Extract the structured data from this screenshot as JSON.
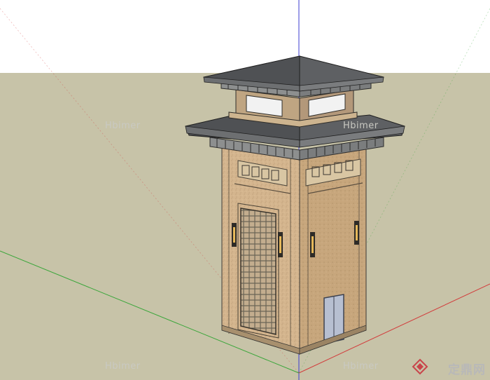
{
  "watermarks": [
    "Hbimer",
    "Hbimer",
    "Hbimer",
    "Hbimer"
  ],
  "brand": {
    "text": "定鼎网",
    "icon": "brand-logo-icon"
  },
  "colors": {
    "sky": "#ffffff",
    "ground": "#c7c3a8",
    "wall": "#d2b48c",
    "roof": "#55575a",
    "door": "#b7bfd1"
  }
}
